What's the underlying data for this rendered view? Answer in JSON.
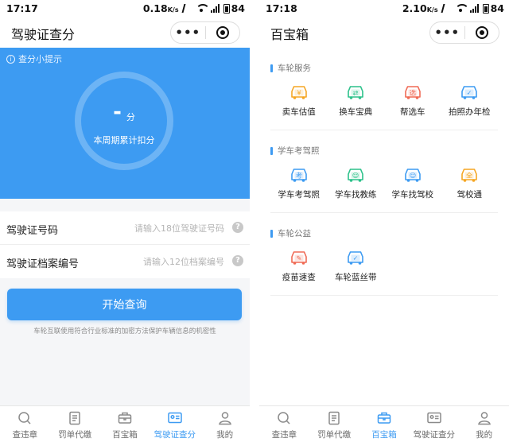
{
  "left": {
    "status": {
      "time": "17:17",
      "net_speed": "0.18",
      "net_unit": "K/s",
      "battery": "84"
    },
    "title": "驾驶证查分",
    "capsule": {
      "more": "•••"
    },
    "hero": {
      "tip": "查分小提示",
      "tip_icon": "info-icon",
      "score": "-",
      "unit": "分",
      "caption": "本周期累计扣分"
    },
    "form": {
      "license_label": "驾驶证号码",
      "license_placeholder": "请输入18位驾驶证号码",
      "archive_label": "驾驶证档案编号",
      "archive_placeholder": "请输入12位档案编号",
      "help": "?"
    },
    "start_button": "开始查询",
    "privacy_note": "车轮互联使用符合行业标准的加密方法保护车辆信息的机密性",
    "tabs": [
      {
        "label": "查违章",
        "icon": "search-icon"
      },
      {
        "label": "罚单代缴",
        "icon": "ticket-icon"
      },
      {
        "label": "百宝箱",
        "icon": "toolbox-icon"
      },
      {
        "label": "驾驶证查分",
        "icon": "license-card-icon",
        "active": true
      },
      {
        "label": "我的",
        "icon": "user-icon"
      }
    ]
  },
  "right": {
    "status": {
      "time": "17:18",
      "net_speed": "2.10",
      "net_unit": "K/s",
      "battery": "84"
    },
    "title": "百宝箱",
    "capsule": {
      "more": "•••"
    },
    "sections": [
      {
        "title": "车轮服务",
        "items": [
          {
            "label": "卖车估值",
            "icon": "sell-car-icon",
            "glyph": "¥",
            "color": "#f5a623"
          },
          {
            "label": "换车宝典",
            "icon": "swap-car-icon",
            "glyph": "⇄",
            "color": "#2cc18a"
          },
          {
            "label": "帮选车",
            "icon": "choose-car-icon",
            "glyph": "选",
            "color": "#f06a55"
          },
          {
            "label": "拍照办年检",
            "icon": "inspection-car-icon",
            "glyph": "✓",
            "color": "#3d9bf2"
          }
        ]
      },
      {
        "title": "学车考驾照",
        "items": [
          {
            "label": "学车考驾照",
            "icon": "exam-icon",
            "glyph": "考",
            "color": "#3d9bf2"
          },
          {
            "label": "学车找教练",
            "icon": "coach-shirt-icon",
            "glyph": "☺",
            "color": "#2cc18a"
          },
          {
            "label": "学车找驾校",
            "icon": "school-car-icon",
            "glyph": "☺",
            "color": "#3d9bf2"
          },
          {
            "label": "驾校通",
            "icon": "school-pass-icon",
            "glyph": "全",
            "color": "#f5a623"
          }
        ]
      },
      {
        "title": "车轮公益",
        "items": [
          {
            "label": "疫苗速查",
            "icon": "vaccine-icon",
            "glyph": "✎",
            "color": "#f06a55"
          },
          {
            "label": "车轮蓝丝带",
            "icon": "blue-ribbon-icon",
            "glyph": "✓",
            "color": "#3d9bf2"
          }
        ]
      }
    ],
    "tabs": [
      {
        "label": "查违章",
        "icon": "search-icon"
      },
      {
        "label": "罚单代缴",
        "icon": "ticket-icon"
      },
      {
        "label": "百宝箱",
        "icon": "toolbox-icon",
        "active": true
      },
      {
        "label": "驾驶证查分",
        "icon": "license-card-icon"
      },
      {
        "label": "我的",
        "icon": "user-icon"
      }
    ]
  },
  "colors": {
    "accent": "#3d9bf2",
    "tab_inactive": "#6b6b6b",
    "page_bg": "#f5f6f8"
  }
}
